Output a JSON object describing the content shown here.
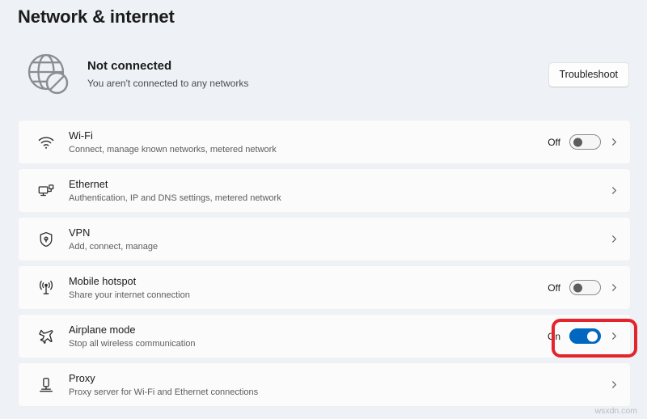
{
  "page": {
    "title": "Network & internet"
  },
  "status": {
    "icon": "globe-disconnected-icon",
    "title": "Not connected",
    "subtitle": "You aren't connected to any networks",
    "troubleshoot_label": "Troubleshoot"
  },
  "settings": [
    {
      "icon": "wifi-icon",
      "title": "Wi-Fi",
      "subtitle": "Connect, manage known networks, metered network",
      "toggle_label": "Off",
      "toggle_state": "off",
      "has_toggle": true
    },
    {
      "icon": "ethernet-icon",
      "title": "Ethernet",
      "subtitle": "Authentication, IP and DNS settings, metered network",
      "toggle_label": "",
      "toggle_state": "none",
      "has_toggle": false
    },
    {
      "icon": "shield-vpn-icon",
      "title": "VPN",
      "subtitle": "Add, connect, manage",
      "toggle_label": "",
      "toggle_state": "none",
      "has_toggle": false
    },
    {
      "icon": "mobile-hotspot-icon",
      "title": "Mobile hotspot",
      "subtitle": "Share your internet connection",
      "toggle_label": "Off",
      "toggle_state": "off",
      "has_toggle": true
    },
    {
      "icon": "airplane-icon",
      "title": "Airplane mode",
      "subtitle": "Stop all wireless communication",
      "toggle_label": "On",
      "toggle_state": "on",
      "has_toggle": true
    },
    {
      "icon": "proxy-server-icon",
      "title": "Proxy",
      "subtitle": "Proxy server for Wi-Fi and Ethernet connections",
      "toggle_label": "",
      "toggle_state": "none",
      "has_toggle": false
    }
  ],
  "annotation": {
    "target": "airplane-mode-toggle",
    "color": "#e4232b"
  },
  "watermark": {
    "text": "wsxdn.com"
  },
  "colors": {
    "accent": "#0067c0",
    "page_background": "#eef1f6",
    "card_background": "#fbfbfb",
    "annotation_red": "#e4232b"
  }
}
